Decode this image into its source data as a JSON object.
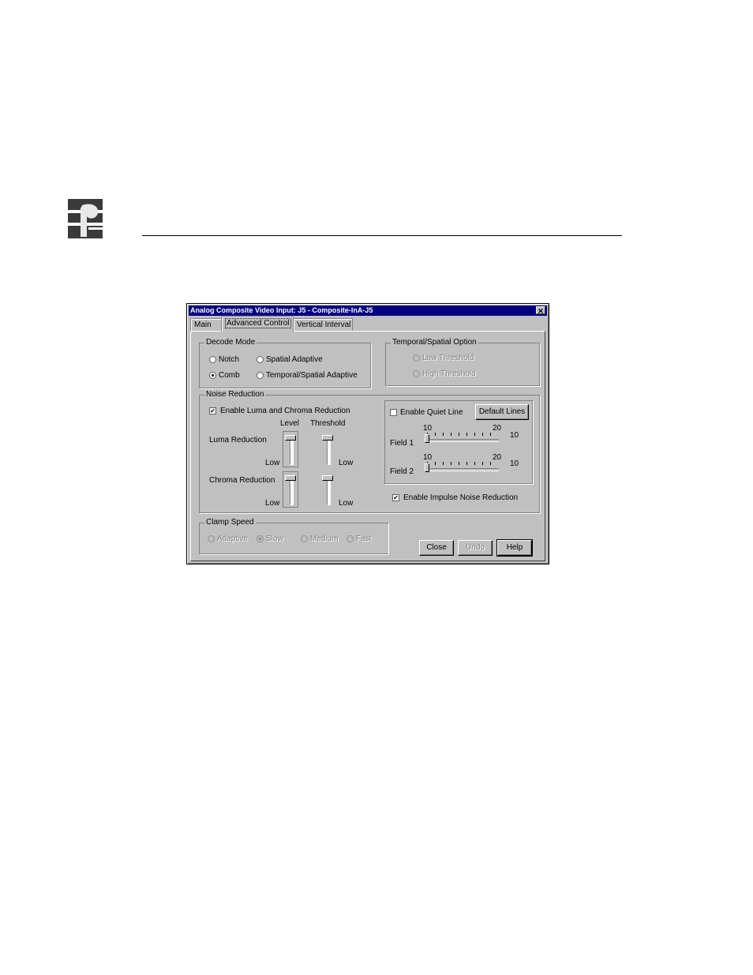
{
  "window": {
    "title": "Analog Composite Video Input: J5 - Composite-InA-J5",
    "close_glyph": "✕"
  },
  "tabs": [
    {
      "label": "Main"
    },
    {
      "label": "Advanced Control",
      "active": true
    },
    {
      "label": "Vertical Interval"
    }
  ],
  "decode_mode": {
    "title": "Decode Mode",
    "options": [
      "Notch",
      "Spatial Adaptive",
      "Comb",
      "Temporal/Spatial Adaptive"
    ],
    "selected": "Comb"
  },
  "temporal_spatial": {
    "title": "Temporal/Spatial Option",
    "options": [
      "Low Threshold",
      "High Threshold"
    ],
    "enabled": false
  },
  "noise_reduction": {
    "title": "Noise Reduction",
    "enable_luma_chroma": {
      "label": "Enable Luma and Chroma Reduction",
      "checked": true,
      "mark": "✔"
    },
    "level_header": "Level",
    "threshold_header": "Threshold",
    "luma_label": "Luma Reduction",
    "chroma_label": "Chroma Reduction",
    "low_label": "Low",
    "quiet_line": {
      "label": "Enable Quiet Line",
      "checked": false
    },
    "default_lines_button": "Default Lines",
    "field1": {
      "label": "Field 1",
      "min": "10",
      "max": "20",
      "value": "10"
    },
    "field2": {
      "label": "Field 2",
      "min": "10",
      "max": "20",
      "value": "10"
    },
    "impulse": {
      "label": "Enable Impulse Noise Reduction",
      "checked": true,
      "mark": "✔"
    }
  },
  "clamp_speed": {
    "title": "Clamp Speed",
    "options": [
      "Adaptive",
      "Slow",
      "Medium",
      "Fast"
    ],
    "selected": "Slow",
    "enabled": false
  },
  "buttons": {
    "close": "Close",
    "undo": "Undo",
    "help": "Help"
  }
}
